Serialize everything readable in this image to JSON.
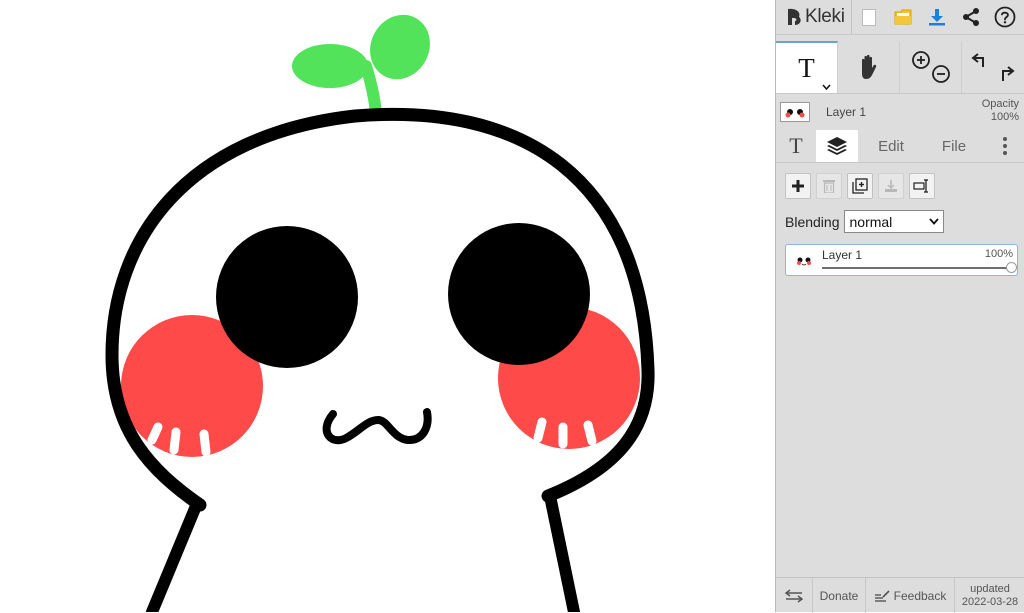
{
  "app": {
    "name": "Kleki"
  },
  "toolbar": {
    "icons": [
      "new-image-icon",
      "open-folder-icon",
      "download-icon",
      "share-icon",
      "help-icon"
    ]
  },
  "tools": {
    "active": "text-tool",
    "items": [
      "text-tool",
      "hand-tool",
      "zoom-in-out",
      "undo-redo"
    ]
  },
  "layer_strip": {
    "name": "Layer 1",
    "opacity_label": "Opacity",
    "opacity_value": "100%"
  },
  "tabs": {
    "text_glyph": "T",
    "edit": "Edit",
    "file": "File",
    "active": "layers"
  },
  "blending": {
    "label": "Blending",
    "value": "normal"
  },
  "layers": [
    {
      "name": "Layer 1",
      "opacity": "100%",
      "opacity_fraction": 1.0
    }
  ],
  "footer": {
    "donate": "Donate",
    "feedback": "Feedback",
    "updated_label": "updated",
    "updated_date": "2022-03-28"
  },
  "colors": {
    "panel_bg": "#dddddd",
    "accent_blue": "#1e7fd8",
    "folder_yellow": "#f2c230",
    "sprout_green": "#52e35a",
    "cheek_red": "#ff4a4a",
    "outline": "#000000"
  }
}
